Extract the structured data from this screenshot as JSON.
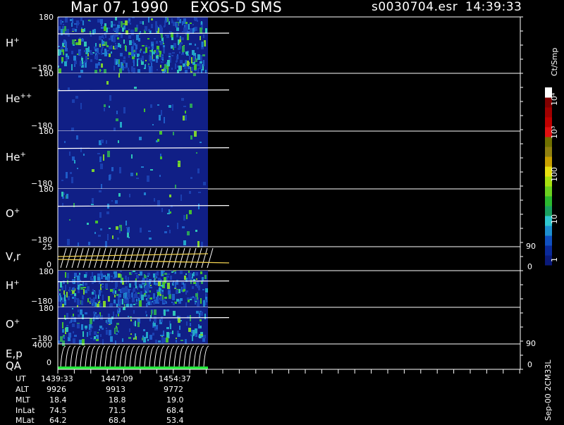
{
  "header": {
    "date": "Mar 07, 1990",
    "instrument": "EXOS-D SMS",
    "file": "s0030704.esr",
    "time": "14:39:33"
  },
  "colors": {
    "background": "#000000",
    "axes": "#ffffff",
    "spectrogram_base": "#101f86",
    "velocity_line": "#f0d050",
    "qa_bar": "#22e83a"
  },
  "chart_data": {
    "type": "heatmap",
    "panels": [
      {
        "name": "H",
        "charge": "+",
        "ytick_top": "180",
        "ytick_bottom": "−180"
      },
      {
        "name": "He",
        "charge": "++",
        "ytick_top": "180",
        "ytick_bottom": "−180"
      },
      {
        "name": "He",
        "charge": "+",
        "ytick_top": "180",
        "ytick_bottom": "−180"
      },
      {
        "name": "O",
        "charge": "+",
        "ytick_top": "180",
        "ytick_bottom": "−180"
      },
      {
        "name": "V,r",
        "charge": "",
        "ytick_top": "25",
        "ytick_bottom": "0",
        "right_top": "90",
        "right_bottom": "0"
      },
      {
        "name": "H",
        "charge": "+",
        "ytick_top": "180",
        "ytick_bottom": "−180"
      },
      {
        "name": "O",
        "charge": "+",
        "ytick_top": "180",
        "ytick_bottom": "−180"
      },
      {
        "name": "E,p",
        "charge": "",
        "ytick_top": "4000",
        "ytick_bottom": "0",
        "right_top": "90",
        "right_bottom": "0"
      }
    ],
    "qa_label": "QA",
    "colorbar": {
      "unit": "Ct/Smp",
      "ticks": [
        "1",
        "10",
        "100",
        "10³",
        "10⁴"
      ],
      "colors": [
        "#0a1a7a",
        "#0a2a9a",
        "#1050c0",
        "#1e8fd0",
        "#30c8d0",
        "#1aa060",
        "#2bb830",
        "#6bd020",
        "#a8e010",
        "#e8e010",
        "#c8a000",
        "#908010",
        "#707000",
        "#e01010",
        "#c00000",
        "#a00000",
        "#800000",
        "#ffffff"
      ]
    },
    "footer_labels": [
      "UT",
      "ALT",
      "MLT",
      "InLat",
      "MLat"
    ],
    "footer_columns": [
      [
        "1439:33",
        "9926",
        "18.4",
        "74.5",
        "64.2"
      ],
      [
        "1447:09",
        "9913",
        "18.8",
        "71.5",
        "68.4"
      ],
      [
        "1454:37",
        "9772",
        "19.0",
        "68.4",
        "53.4"
      ]
    ],
    "side_note": "Sep-00 2CM33L"
  }
}
